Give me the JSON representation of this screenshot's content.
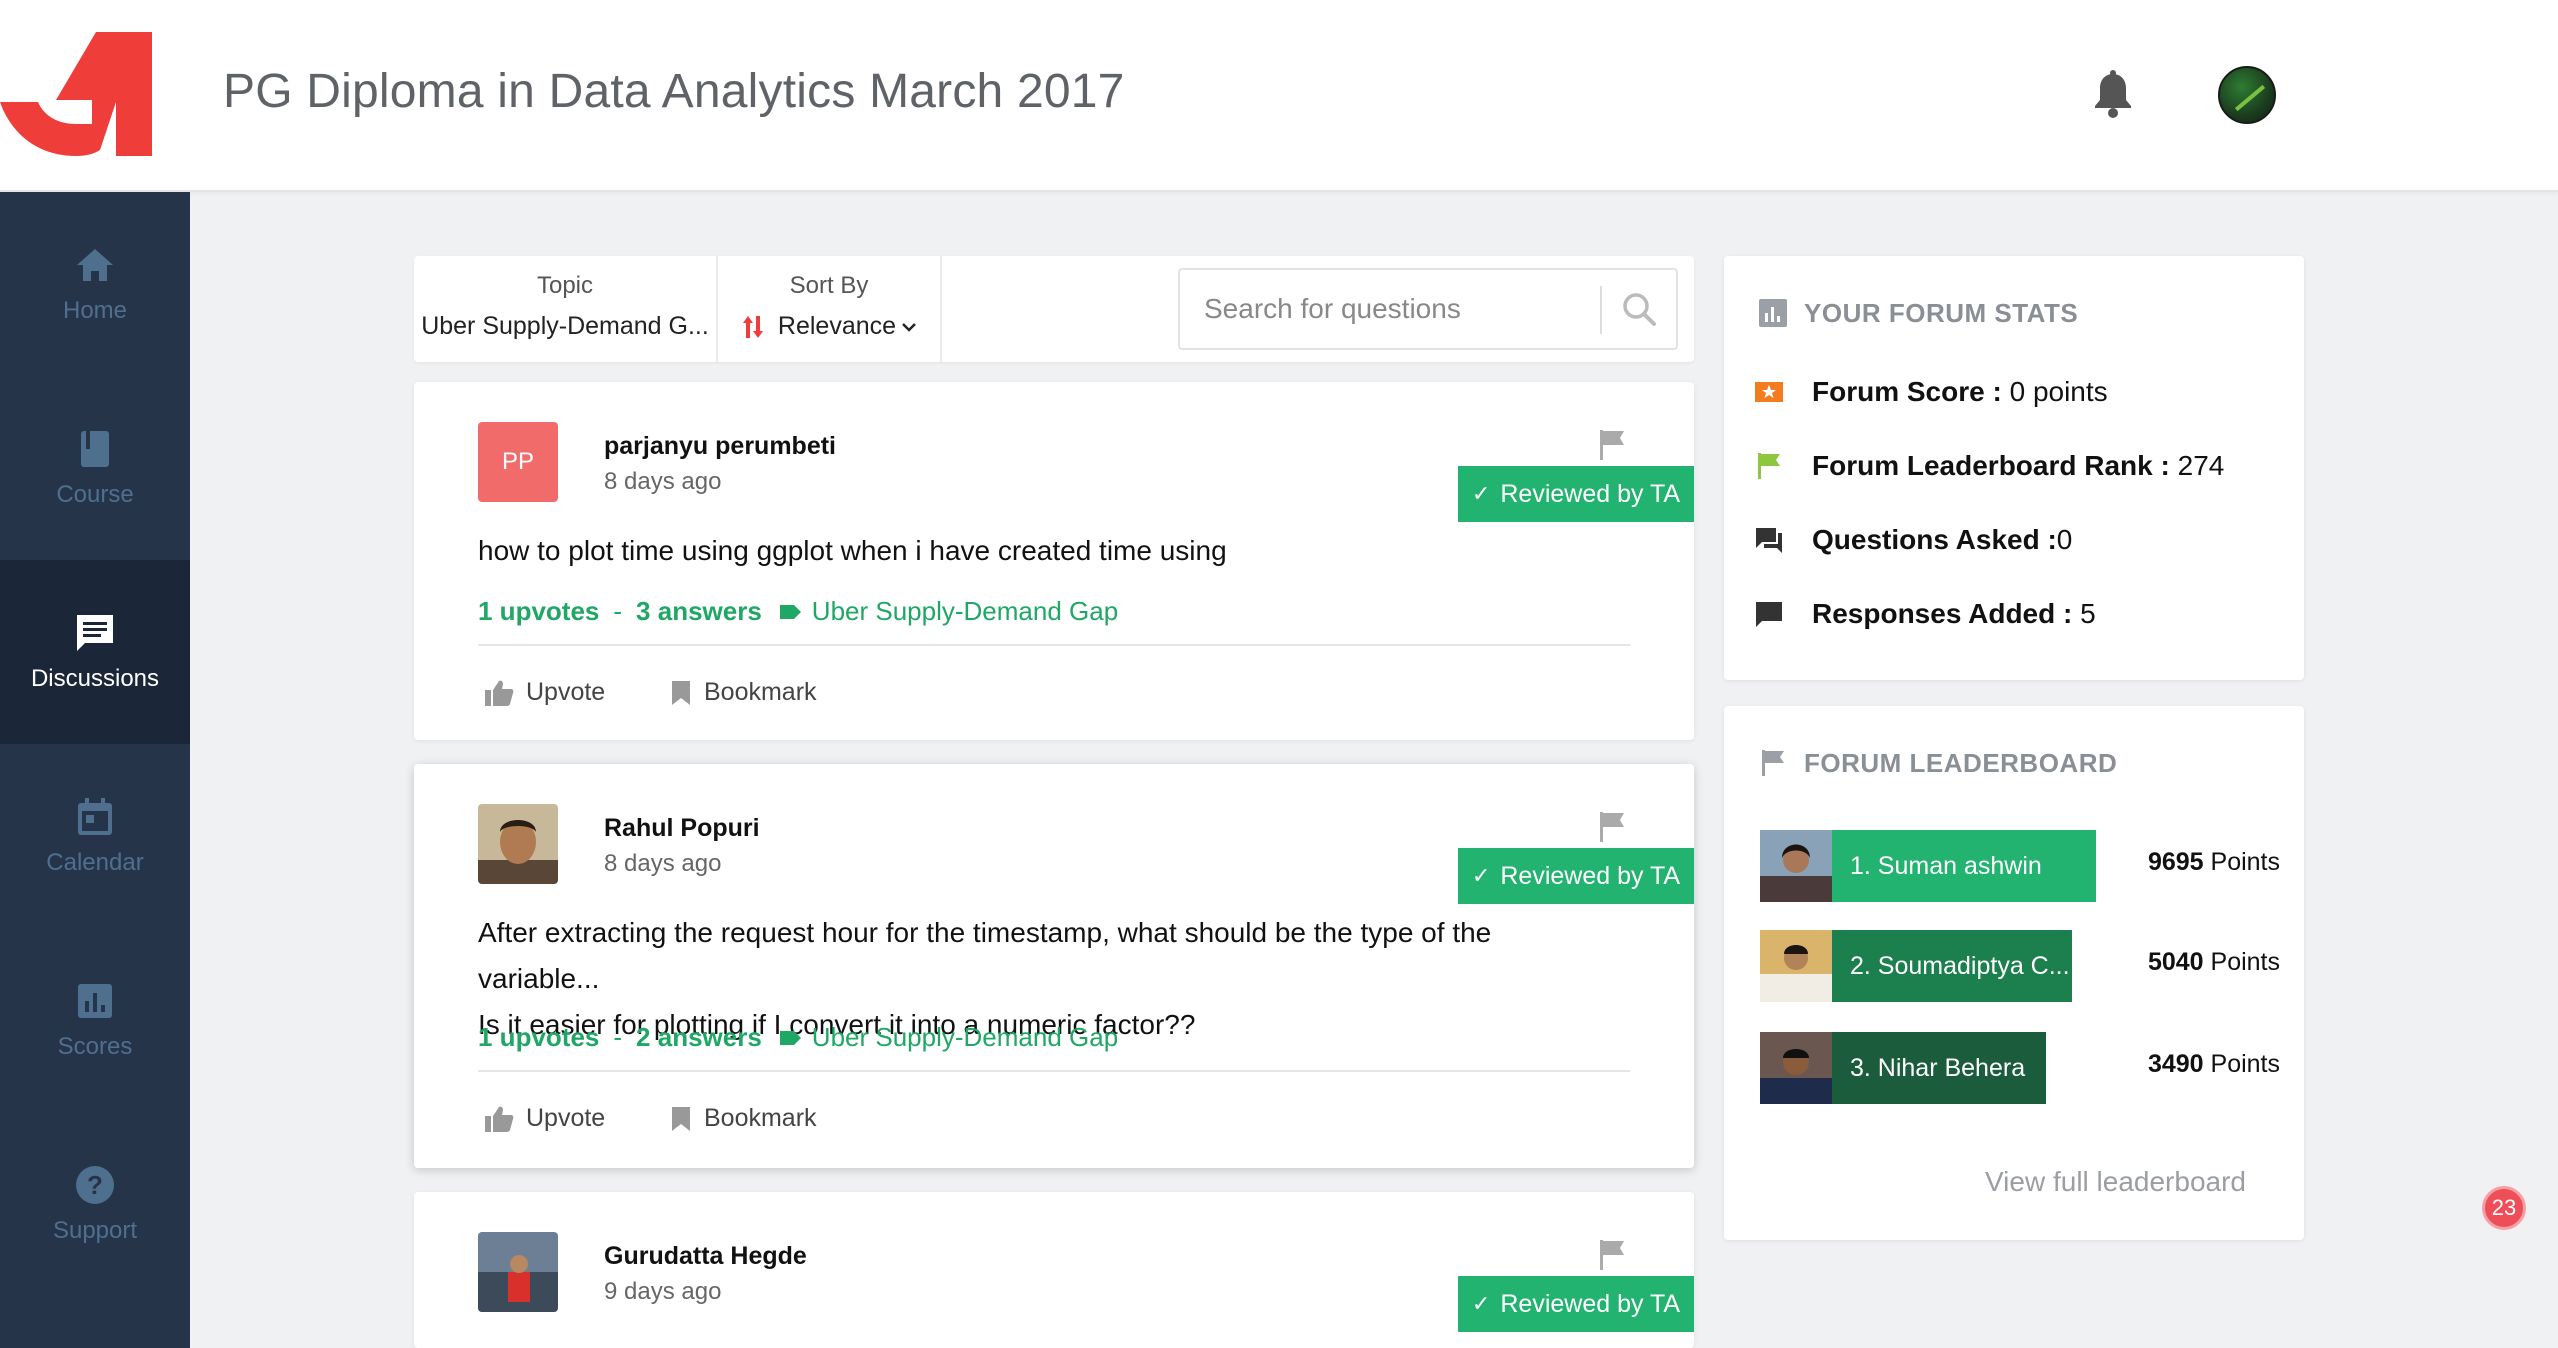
{
  "header": {
    "title": "PG Diploma in Data Analytics March 2017",
    "brand_color": "#ef3e3a"
  },
  "sidebar": {
    "items": [
      {
        "label": "Home",
        "icon": "home-icon",
        "active": false
      },
      {
        "label": "Course",
        "icon": "book-icon",
        "active": false
      },
      {
        "label": "Discussions",
        "icon": "chat-icon",
        "active": true
      },
      {
        "label": "Calendar",
        "icon": "calendar-icon",
        "active": false
      },
      {
        "label": "Scores",
        "icon": "bar-chart-icon",
        "active": false
      },
      {
        "label": "Support",
        "icon": "help-icon",
        "active": false
      }
    ]
  },
  "filters": {
    "topic_label": "Topic",
    "topic_value": "Uber Supply-Demand G...",
    "sort_label": "Sort By",
    "sort_value": "Relevance",
    "search_placeholder": "Search for questions"
  },
  "posts": [
    {
      "initials": "PP",
      "author": "parjanyu perumbeti",
      "time": "8 days ago",
      "badge": "Reviewed by TA",
      "text": "how to plot time using ggplot when i have created time using",
      "upvotes": "1 upvotes",
      "sep": "-",
      "answers": "3 answers",
      "tag": "Uber Supply-Demand Gap",
      "upvote_label": "Upvote",
      "bookmark_label": "Bookmark"
    },
    {
      "author": "Rahul Popuri",
      "time": "8 days ago",
      "badge": "Reviewed by TA",
      "text_line1": "After extracting the request hour for the timestamp, what should be the type of the variable...",
      "text_line2": "Is it easier for plotting if I convert it into a numeric factor??",
      "upvotes": "1 upvotes",
      "sep": "-",
      "answers": "2 answers",
      "tag": "Uber Supply-Demand Gap",
      "upvote_label": "Upvote",
      "bookmark_label": "Bookmark"
    },
    {
      "author": "Gurudatta Hegde",
      "time": "9 days ago",
      "badge": "Reviewed by TA"
    }
  ],
  "forum_stats": {
    "title": "YOUR FORUM STATS",
    "rows": [
      {
        "label": "Forum Score :",
        "value": "0 points",
        "icon": "star-badge-icon",
        "color": "#f47b20"
      },
      {
        "label": "Forum Leaderboard Rank :",
        "value": "274",
        "icon": "flag-icon",
        "color": "#8dc63f"
      },
      {
        "label": "Questions Asked :",
        "value": "0",
        "icon": "question-chat-icon",
        "color": "#333333"
      },
      {
        "label": "Responses Added :",
        "value": "5",
        "icon": "response-chat-icon",
        "color": "#333333"
      }
    ]
  },
  "leaderboard": {
    "title": "FORUM LEADERBOARD",
    "entries": [
      {
        "name": "1. Suman ashwin",
        "points": "9695",
        "points_unit": "Points",
        "color": "#21b36f"
      },
      {
        "name": "2. Soumadiptya C...",
        "points": "5040",
        "points_unit": "Points",
        "color": "#1c7f4e"
      },
      {
        "name": "3. Nihar Behera",
        "points": "3490",
        "points_unit": "Points",
        "color": "#1a5c3c"
      }
    ],
    "view_full": "View full leaderboard"
  },
  "notification_count": "23"
}
